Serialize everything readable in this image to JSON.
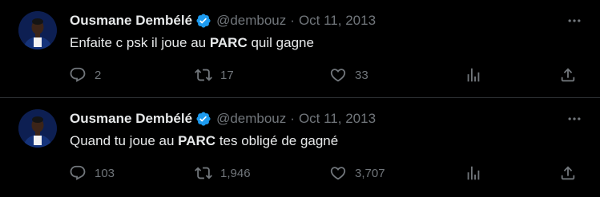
{
  "tweets": [
    {
      "display_name": "Ousmane Dembélé",
      "handle": "@dembouz",
      "separator": "·",
      "date": "Oct 11, 2013",
      "text_before": "Enfaite c psk il joue au ",
      "text_bold": "PARC",
      "text_after": " quil gagne",
      "replies": "2",
      "retweets": "17",
      "likes": "33"
    },
    {
      "display_name": "Ousmane Dembélé",
      "handle": "@dembouz",
      "separator": "·",
      "date": "Oct 11, 2013",
      "text_before": "Quand tu joue au ",
      "text_bold": "PARC",
      "text_after": " tes obligé de gagné",
      "replies": "103",
      "retweets": "1,946",
      "likes": "3,707"
    }
  ],
  "icons": {
    "verified": "verified-badge-icon",
    "more": "more-horizontal-icon",
    "reply": "reply-icon",
    "retweet": "retweet-icon",
    "like": "heart-icon",
    "views": "views-chart-icon",
    "share": "share-icon"
  },
  "colors": {
    "background": "#000000",
    "primary_text": "#e7e9ea",
    "secondary_text": "#71767b",
    "verified_blue": "#1d9bf0",
    "divider": "#2f3336"
  }
}
